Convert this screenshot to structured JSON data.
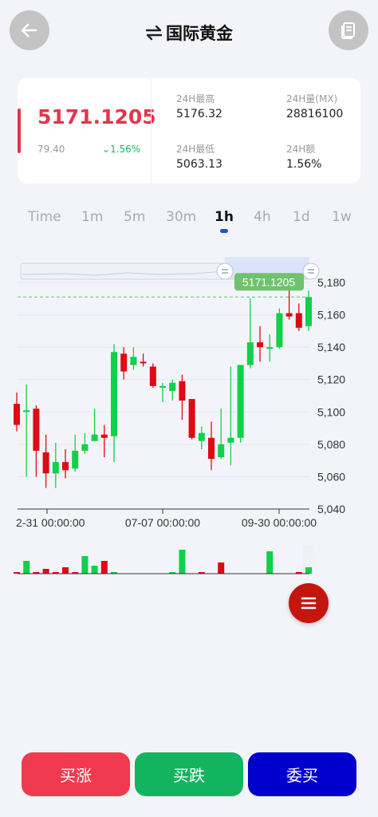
{
  "header": {
    "title": "国际黄金",
    "back_icon": "back-arrow-icon",
    "swap_icon": "swap-arrows-icon",
    "doc_icon": "document-icon"
  },
  "quote": {
    "price": "5171.1205",
    "change_value": "79.40",
    "change_percent": "1.56%",
    "stats": [
      {
        "label": "24H最高",
        "value": "5176.32"
      },
      {
        "label": "24H量(MX)",
        "value": "28816100"
      },
      {
        "label": "24H最低",
        "value": "5063.13"
      },
      {
        "label": "24H额",
        "value": "1.56%"
      }
    ],
    "colors": {
      "up": "#0fd14a",
      "down": "#de0a14",
      "price": "#e2374a"
    }
  },
  "timeframes": [
    "Time",
    "1m",
    "5m",
    "30m",
    "1h",
    "4h",
    "1d",
    "1w"
  ],
  "active_timeframe": "1h",
  "chart_data": {
    "type": "candlestick",
    "last_price_label": "5171.1205",
    "y_ticks": [
      "5,180",
      "5,160",
      "5,140",
      "5,120",
      "5,100",
      "5,080",
      "5,060",
      "5,040"
    ],
    "x_ticks": [
      "2-31 00:00:00",
      "07-07 00:00:00",
      "09-30 00:00:00"
    ],
    "ylim": [
      5040,
      5180
    ],
    "candles": [
      {
        "o": 5105,
        "c": 5092,
        "h": 5112,
        "l": 5088
      },
      {
        "o": 5100,
        "c": 5101,
        "h": 5117,
        "l": 5060
      },
      {
        "o": 5102,
        "c": 5076,
        "h": 5104,
        "l": 5060
      },
      {
        "o": 5075,
        "c": 5062,
        "h": 5086,
        "l": 5053
      },
      {
        "o": 5062,
        "c": 5069,
        "h": 5081,
        "l": 5053
      },
      {
        "o": 5069,
        "c": 5064,
        "h": 5077,
        "l": 5059
      },
      {
        "o": 5065,
        "c": 5076,
        "h": 5086,
        "l": 5063
      },
      {
        "o": 5076,
        "c": 5080,
        "h": 5087,
        "l": 5074
      },
      {
        "o": 5082,
        "c": 5086,
        "h": 5102,
        "l": 5082
      },
      {
        "o": 5086,
        "c": 5084,
        "h": 5092,
        "l": 5072
      },
      {
        "o": 5085,
        "c": 5137,
        "h": 5142,
        "l": 5069
      },
      {
        "o": 5136,
        "c": 5125,
        "h": 5140,
        "l": 5120
      },
      {
        "o": 5129,
        "c": 5134,
        "h": 5140,
        "l": 5126
      },
      {
        "o": 5131,
        "c": 5130,
        "h": 5136,
        "l": 5128
      },
      {
        "o": 5128,
        "c": 5116,
        "h": 5130,
        "l": 5115
      },
      {
        "o": 5116,
        "c": 5116,
        "h": 5118,
        "l": 5106
      },
      {
        "o": 5113,
        "c": 5118,
        "h": 5120,
        "l": 5107
      },
      {
        "o": 5119,
        "c": 5107,
        "h": 5123,
        "l": 5095
      },
      {
        "o": 5108,
        "c": 5084,
        "h": 5108,
        "l": 5083
      },
      {
        "o": 5082,
        "c": 5087,
        "h": 5091,
        "l": 5077
      },
      {
        "o": 5084,
        "c": 5071,
        "h": 5094,
        "l": 5064
      },
      {
        "o": 5072,
        "c": 5080,
        "h": 5102,
        "l": 5071
      },
      {
        "o": 5081,
        "c": 5084,
        "h": 5128,
        "l": 5067
      },
      {
        "o": 5084,
        "c": 5129,
        "h": 5129,
        "l": 5081
      },
      {
        "o": 5129,
        "c": 5143,
        "h": 5170,
        "l": 5127
      },
      {
        "o": 5143,
        "c": 5140,
        "h": 5153,
        "l": 5131
      },
      {
        "o": 5139,
        "c": 5140,
        "h": 5148,
        "l": 5131
      },
      {
        "o": 5140,
        "c": 5161,
        "h": 5164,
        "l": 5139
      },
      {
        "o": 5161,
        "c": 5159,
        "h": 5176,
        "l": 5157
      },
      {
        "o": 5161,
        "c": 5152,
        "h": 5167,
        "l": 5150
      },
      {
        "o": 5153,
        "c": 5171,
        "h": 5175,
        "l": 5150
      }
    ],
    "volumes": [
      1,
      8,
      1,
      3,
      1,
      4,
      1,
      11,
      5,
      8,
      1,
      0,
      0,
      0,
      0,
      0,
      1,
      15,
      0,
      1,
      0,
      7,
      0,
      0,
      0,
      0,
      14,
      0,
      0,
      1,
      4
    ],
    "volume_colors": [
      "down",
      "up",
      "down",
      "down",
      "down",
      "down",
      "down",
      "up",
      "up",
      "down",
      "up",
      "up",
      "down",
      "down",
      "down",
      "down",
      "up",
      "up",
      "down",
      "down",
      "down",
      "down",
      "up",
      "up",
      "up",
      "up",
      "up",
      "up",
      "down",
      "down",
      "up"
    ],
    "grid": true
  },
  "actions": {
    "buy_up": "买涨",
    "buy_down": "买跌",
    "entrust": "委买"
  },
  "fab_icon": "menu-icon"
}
